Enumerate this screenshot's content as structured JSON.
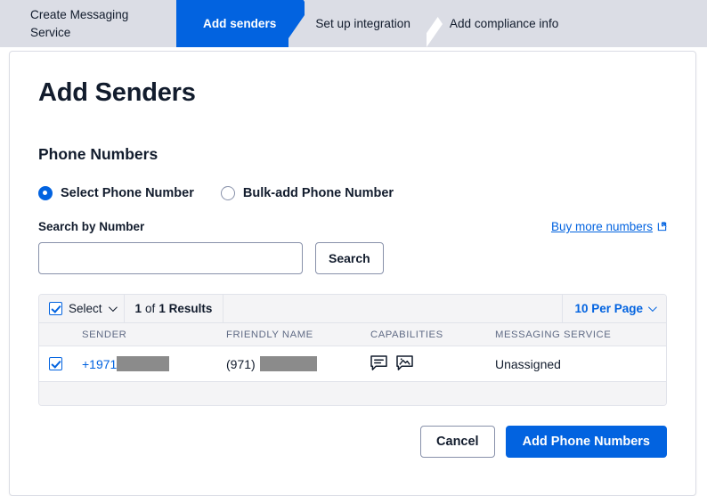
{
  "stepnav": {
    "steps": [
      {
        "label": "Create Messaging Service",
        "active": false
      },
      {
        "label": "Add senders",
        "active": true
      },
      {
        "label": "Set up integration",
        "active": false
      },
      {
        "label": "Add compliance info",
        "active": false
      }
    ]
  },
  "page": {
    "title": "Add Senders",
    "section_title": "Phone Numbers"
  },
  "mode_options": {
    "select_phone_number": "Select Phone Number",
    "bulk_add_phone_number": "Bulk-add Phone Number",
    "selected": "Select Phone Number"
  },
  "search": {
    "label": "Search by Number",
    "value": "",
    "placeholder": "",
    "button_label": "Search",
    "buy_more_link": "Buy more numbers",
    "buy_more_icon": "external-link-icon"
  },
  "table": {
    "toolbar": {
      "select_label": "Select",
      "select_chevron_icon": "chevron-down-icon",
      "select_all_checked": true,
      "results_count": "1",
      "results_of": "of",
      "results_total": "1 Results",
      "per_page_label": "10 Per Page",
      "per_page_chevron_icon": "chevron-down-icon"
    },
    "columns": [
      "SENDER",
      "FRIENDLY NAME",
      "CAPABILITIES",
      "MESSAGING SERVICE"
    ],
    "rows": [
      {
        "checked": true,
        "sender": "+1971",
        "sender_redacted": true,
        "friendly_name": "(971)",
        "friendly_name_redacted": true,
        "capabilities": [
          "sms-icon",
          "mms-icon"
        ],
        "messaging_service": "Unassigned"
      }
    ]
  },
  "footer": {
    "cancel_label": "Cancel",
    "submit_label": "Add Phone Numbers"
  },
  "colors": {
    "accent": "#0263e0",
    "step_inactive_bg": "#dbdde5",
    "text": "#121c2d",
    "muted_text": "#606b85",
    "table_header_bg": "#f4f4f6",
    "border": "#e1e3ea",
    "redaction": "#8b8b8b"
  }
}
